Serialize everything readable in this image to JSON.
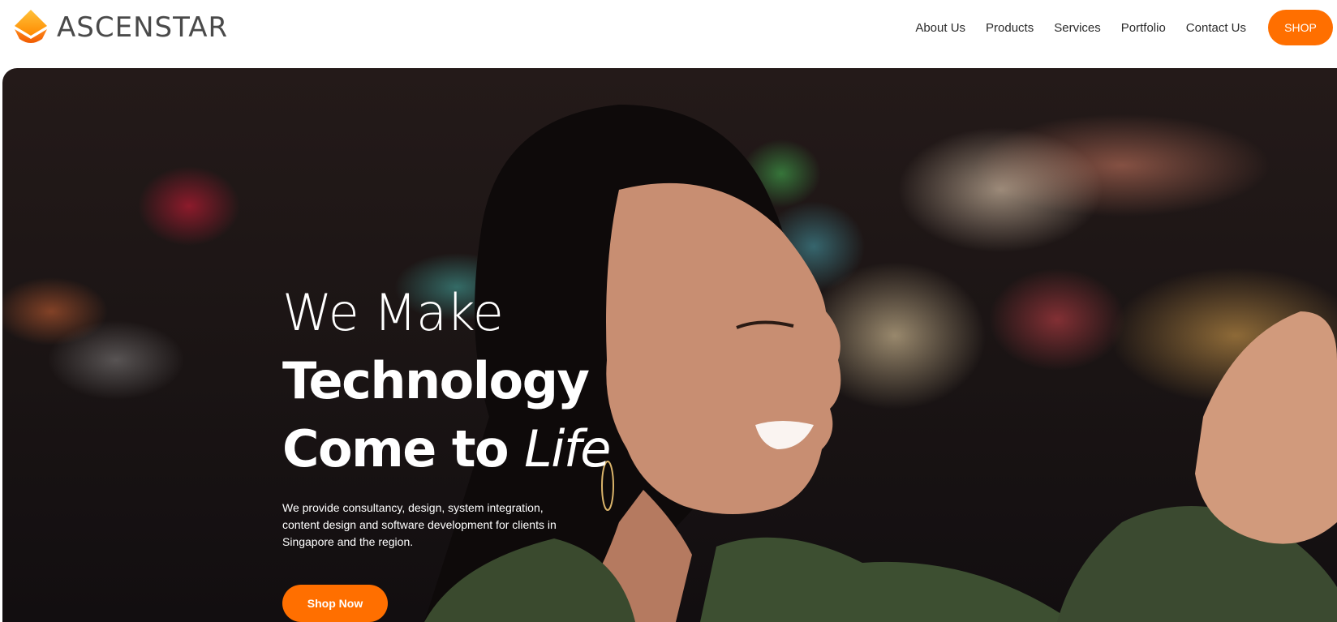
{
  "brand": {
    "name": "ASCENSTAR",
    "logo_icon": "ascenstar-logo-mark",
    "accent_color": "#ff6f00"
  },
  "nav": {
    "items": [
      {
        "label": "About Us"
      },
      {
        "label": "Products"
      },
      {
        "label": "Services"
      },
      {
        "label": "Portfolio"
      },
      {
        "label": "Contact Us"
      }
    ],
    "shop_label": "SHOP"
  },
  "hero": {
    "headline_line1": "We Make",
    "headline_line2": "Technology",
    "headline_line3_prefix": "Come to ",
    "headline_line3_italic": "Life",
    "description": "We provide consultancy, design, system integration, content design and software development for clients in Singapore and the region.",
    "cta_label": "Shop Now",
    "background_image": "smiling-woman-night-city-bokeh"
  }
}
